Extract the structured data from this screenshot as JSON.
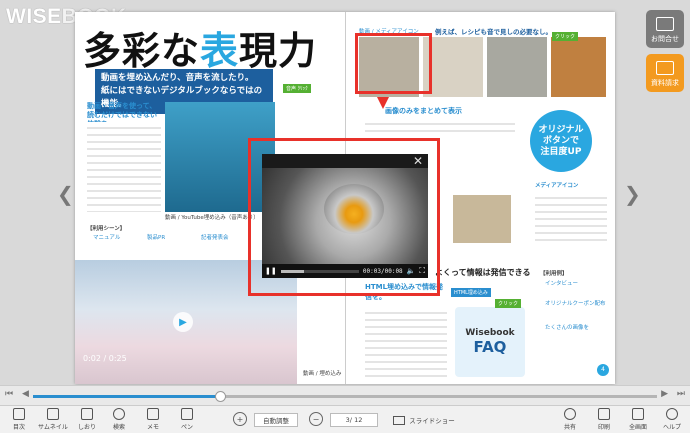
{
  "app": {
    "logo_a": "WISE",
    "logo_b": "BOOK"
  },
  "side_buttons": [
    {
      "label": "お問合せ",
      "color": "#7a7a7a"
    },
    {
      "label": "資料請求",
      "color": "#f39a1f"
    }
  ],
  "page": {
    "title_a": "多彩な",
    "title_b": "表",
    "title_c": "現力",
    "catch_line1": "動画を埋め込んだり、音声を流したり。",
    "catch_line2": "紙にはできないデジタルブックならではの機能。",
    "voice_tag": "音声 ｸﾘｯｸ",
    "left_head": "動画・音声を使って、読むだけではできない体験を",
    "reef_caption": "動画 / YouTube埋め込み（音声あり）",
    "usage_head": "【利用シーン】",
    "usage": [
      "マニュアル",
      "製品PR",
      "記者発表会"
    ],
    "video_time_small": "0:02 / 0:25",
    "video_caption": "動画 / 埋め込み",
    "right_tag": "動画 / メディアアイコン",
    "right_lead": "例えば、レシピも音で見しの必要なし。",
    "click_tag": "クリック",
    "sec2_head": "画像のみをまとめて表示",
    "circle_text_1": "オリジナル",
    "circle_text_2": "ボタンで",
    "circle_text_3": "注目度UP",
    "media_icon_tag": "メディアアイコン",
    "bottom_head": "よくって情報は発信できる",
    "html_head": "HTML埋め込みで情報発信を。",
    "html_tag": "HTML埋め込み",
    "faq_a": "Wisebook",
    "faq_b": "FAQ",
    "right_usage_head": "【利用例】",
    "right_usage": [
      "インタビュー",
      "オリジナルクーポン配布",
      "たくさんの画像を"
    ],
    "page_number": "4"
  },
  "video": {
    "current": "00:03",
    "duration": "00:08",
    "progress": 0.3
  },
  "seek": {
    "position": 0.3
  },
  "toolbar": {
    "left": [
      {
        "label": "目次",
        "name": "toc"
      },
      {
        "label": "サムネイル",
        "name": "thumbnail"
      },
      {
        "label": "しおり",
        "name": "bookmark"
      },
      {
        "label": "検索",
        "name": "search"
      },
      {
        "label": "メモ",
        "name": "memo"
      },
      {
        "label": "ペン",
        "name": "pen"
      }
    ],
    "auto_fit": "自動調整",
    "page_current": "3/",
    "page_total": "12",
    "slideshow": "スライドショー",
    "right": [
      {
        "label": "共有",
        "name": "share"
      },
      {
        "label": "印刷",
        "name": "print"
      },
      {
        "label": "全画面",
        "name": "fullscreen"
      },
      {
        "label": "ヘルプ",
        "name": "help"
      }
    ]
  }
}
